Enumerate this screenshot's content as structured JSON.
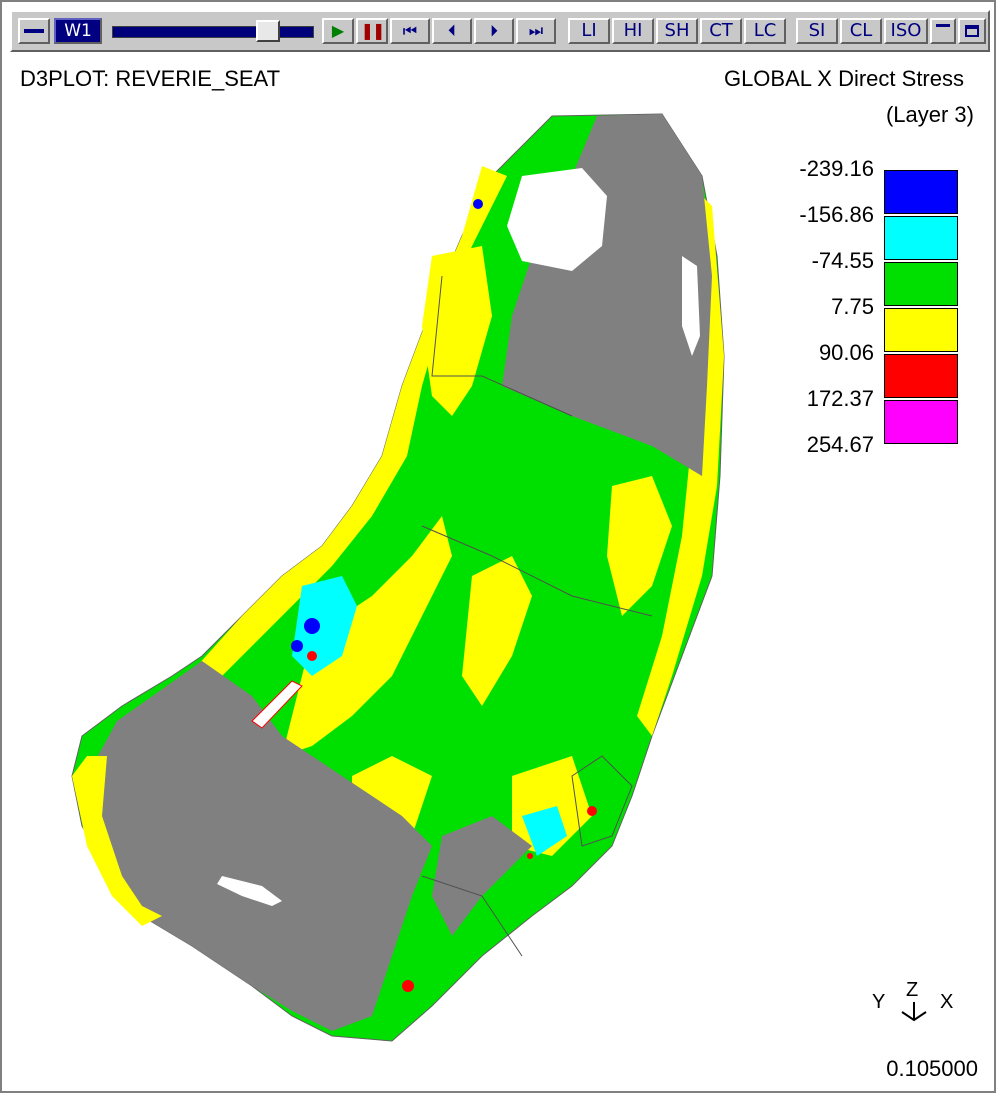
{
  "toolbar": {
    "window_label": "W1",
    "play_glyph": "▶",
    "pause_glyph": "❚❚",
    "first_glyph": "⏮",
    "prev_glyph": "⏴",
    "next_glyph": "⏵",
    "last_glyph": "⏭",
    "buttons": [
      "LI",
      "HI",
      "SH",
      "CT",
      "LC",
      "SI",
      "CL",
      "ISO"
    ],
    "slider_fraction": 0.78
  },
  "plot": {
    "title": "D3PLOT: REVERIE_SEAT",
    "quantity": "GLOBAL X Direct Stress",
    "layer": "(Layer  3)",
    "time": "0.105000"
  },
  "legend": {
    "values": [
      "-239.16",
      "-156.86",
      "-74.55",
      "7.75",
      "90.06",
      "172.37",
      "254.67"
    ],
    "colors": [
      "#0000ff",
      "#00ffff",
      "#00e000",
      "#ffff00",
      "#ff0000",
      "#ff00ff"
    ]
  },
  "axes": {
    "y": "Y",
    "z": "Z",
    "x": "X"
  },
  "colors": {
    "unstressed": "#808080",
    "green": "#00e000",
    "yellow": "#ffff00",
    "cyan": "#00ffff",
    "blue": "#0000ff",
    "red": "#ff0000"
  }
}
